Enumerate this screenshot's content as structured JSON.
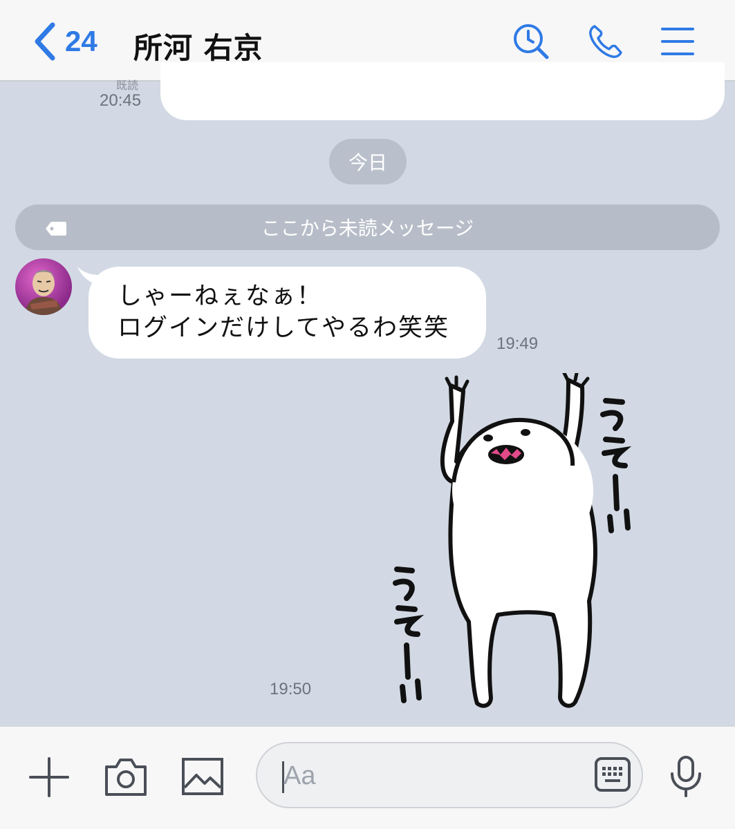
{
  "header": {
    "back_count": "24",
    "title": "所河 右京",
    "accent_color": "#2f7ae5",
    "icons": [
      "back-chevron-icon",
      "search-history-icon",
      "phone-icon",
      "menu-icon"
    ]
  },
  "messages": {
    "prev_read_label": "既読",
    "prev_time": "20:45",
    "date_separator": "今日",
    "unread_label": "ここから未読メッセージ",
    "incoming": {
      "lines": [
        "しゃーねぇなぁ！",
        "ログインだけしてやるわ笑笑"
      ],
      "time": "19:49"
    },
    "sticker": {
      "icon": "cheering-creature-sticker",
      "text_right": "うぇーい",
      "text_left": "うぇーい",
      "time": "19:50"
    }
  },
  "input_bar": {
    "placeholder": "Aa",
    "icons": [
      "plus-icon",
      "camera-icon",
      "image-icon",
      "keyboard-icon",
      "microphone-icon"
    ]
  }
}
